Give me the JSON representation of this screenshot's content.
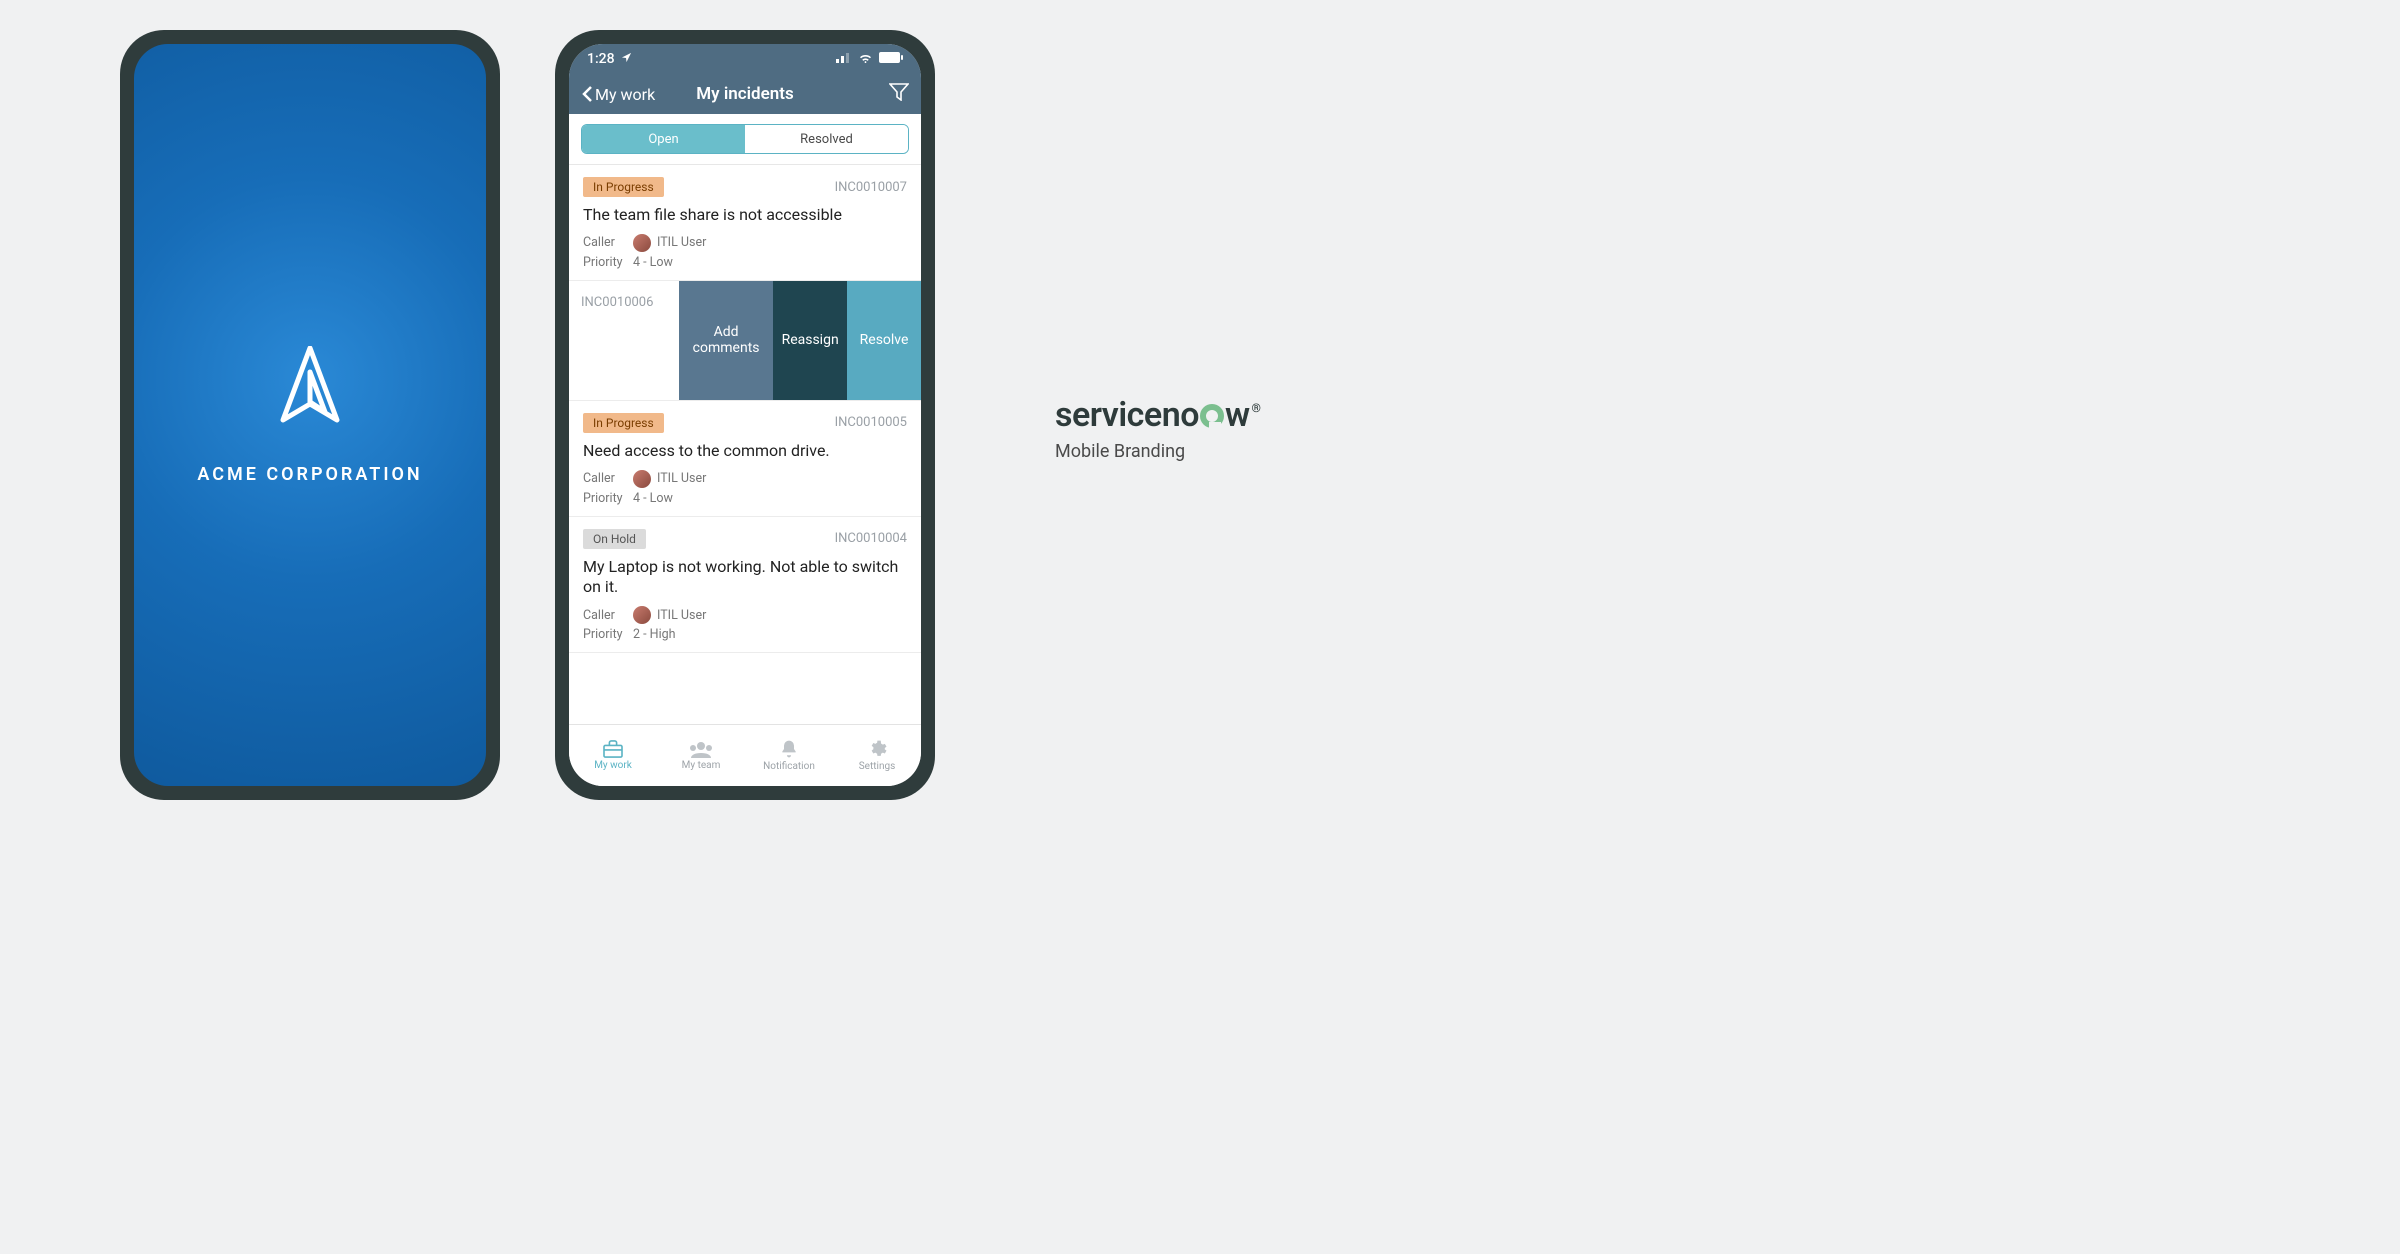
{
  "splash": {
    "company_name": "ACME CORPORATION"
  },
  "status_bar": {
    "time": "1:28"
  },
  "nav": {
    "back_label": "My work",
    "title": "My incidents"
  },
  "segments": {
    "open": "Open",
    "resolved": "Resolved"
  },
  "incidents": [
    {
      "status": "In Progress",
      "status_kind": "progress",
      "id": "INC0010007",
      "title": "The team file share is not accessible",
      "caller_label": "Caller",
      "caller_name": "ITIL User",
      "priority_label": "Priority",
      "priority_value": "4 - Low"
    },
    {
      "id": "INC0010006",
      "swipe": true,
      "actions": {
        "add": "Add comments",
        "reassign": "Reassign",
        "resolve": "Resolve"
      }
    },
    {
      "status": "In Progress",
      "status_kind": "progress",
      "id": "INC0010005",
      "title": "Need access to the common drive.",
      "caller_label": "Caller",
      "caller_name": "ITIL User",
      "priority_label": "Priority",
      "priority_value": "4 - Low"
    },
    {
      "status": "On Hold",
      "status_kind": "hold",
      "id": "INC0010004",
      "title": "My Laptop is not working. Not able to switch on it.",
      "caller_label": "Caller",
      "caller_name": "ITIL User",
      "priority_label": "Priority",
      "priority_value": "2 - High"
    }
  ],
  "tabs": {
    "my_work": "My work",
    "my_team": "My team",
    "notification": "Notification",
    "settings": "Settings"
  },
  "brand": {
    "name_pre": "serviceno",
    "name_post": "w",
    "subtitle": "Mobile Branding"
  }
}
